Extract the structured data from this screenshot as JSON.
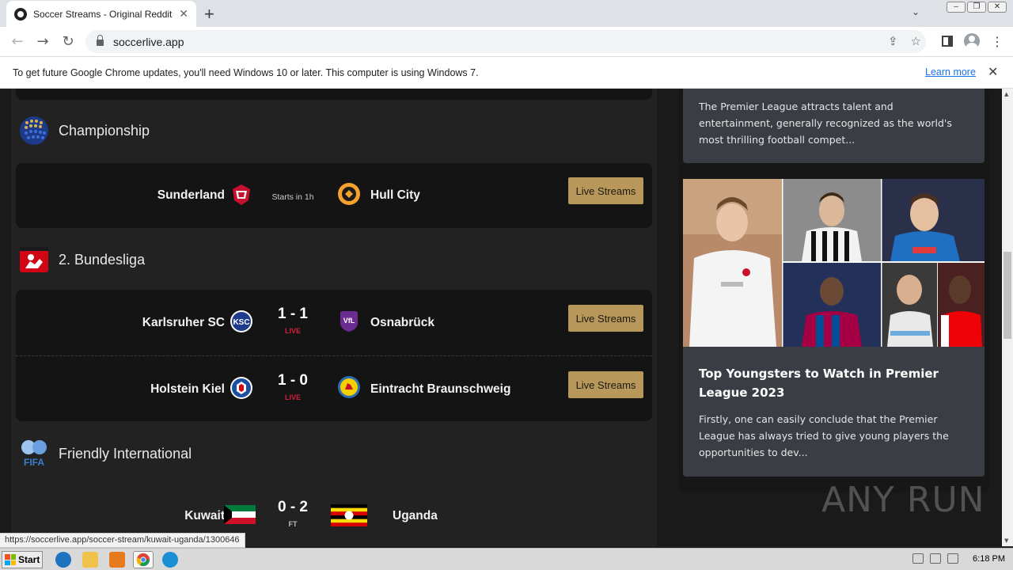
{
  "browser": {
    "tab_title": "Soccer Streams - Original Reddit Soccer Streams",
    "tab_close": "✕",
    "new_tab": "+",
    "url": "soccerlive.app",
    "infobar_message": "To get future Google Chrome updates, you'll need Windows 10 or later. This computer is using Windows 7.",
    "infobar_link": "Learn more",
    "status_url": "https://soccerlive.app/soccer-stream/kuwait-uganda/1300646"
  },
  "leagues": [
    {
      "name": "Championship",
      "matches": [
        {
          "home": "Sunderland",
          "away": "Hull City",
          "status": "Starts in 1h",
          "button": "Live Streams"
        }
      ]
    },
    {
      "name": "2. Bundesliga",
      "matches": [
        {
          "home": "Karlsruher SC",
          "away": "Osnabrück",
          "score": "1 - 1",
          "status": "LIVE",
          "button": "Live Streams"
        },
        {
          "home": "Holstein Kiel",
          "away": "Eintracht Braunschweig",
          "score": "1 - 0",
          "status": "LIVE",
          "button": "Live Streams"
        }
      ]
    },
    {
      "name": "Friendly International",
      "matches": [
        {
          "home": "Kuwait",
          "away": "Uganda",
          "score": "0 - 2",
          "status": "FT"
        }
      ]
    }
  ],
  "sidebar": {
    "article1": {
      "desc": "The Premier League attracts talent and entertainment, generally recognized as the world's most thrilling football compet..."
    },
    "article2": {
      "title": "Top Youngsters to Watch in Premier League 2023",
      "desc": "Firstly, one can easily conclude that the Premier League has always tried to give young players the opportunities to dev..."
    }
  },
  "watermark": "ANY RUN",
  "taskbar": {
    "start": "Start",
    "clock": "6:18 PM"
  },
  "colors": {
    "button_gold": "#b8975a",
    "live_red": "#d0213b",
    "page_bg": "#1a1a1a"
  }
}
